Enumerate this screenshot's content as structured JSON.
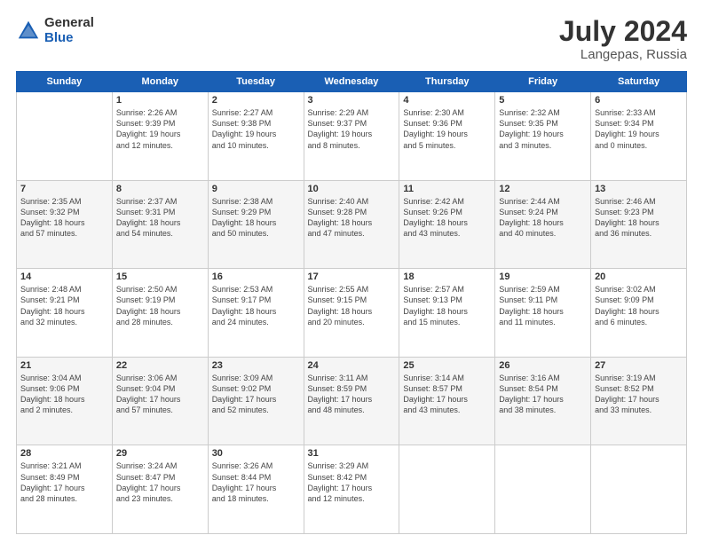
{
  "header": {
    "logo_general": "General",
    "logo_blue": "Blue",
    "month_year": "July 2024",
    "location": "Langepas, Russia"
  },
  "columns": [
    "Sunday",
    "Monday",
    "Tuesday",
    "Wednesday",
    "Thursday",
    "Friday",
    "Saturday"
  ],
  "weeks": [
    [
      {
        "day": "",
        "info": ""
      },
      {
        "day": "1",
        "info": "Sunrise: 2:26 AM\nSunset: 9:39 PM\nDaylight: 19 hours\nand 12 minutes."
      },
      {
        "day": "2",
        "info": "Sunrise: 2:27 AM\nSunset: 9:38 PM\nDaylight: 19 hours\nand 10 minutes."
      },
      {
        "day": "3",
        "info": "Sunrise: 2:29 AM\nSunset: 9:37 PM\nDaylight: 19 hours\nand 8 minutes."
      },
      {
        "day": "4",
        "info": "Sunrise: 2:30 AM\nSunset: 9:36 PM\nDaylight: 19 hours\nand 5 minutes."
      },
      {
        "day": "5",
        "info": "Sunrise: 2:32 AM\nSunset: 9:35 PM\nDaylight: 19 hours\nand 3 minutes."
      },
      {
        "day": "6",
        "info": "Sunrise: 2:33 AM\nSunset: 9:34 PM\nDaylight: 19 hours\nand 0 minutes."
      }
    ],
    [
      {
        "day": "7",
        "info": "Sunrise: 2:35 AM\nSunset: 9:32 PM\nDaylight: 18 hours\nand 57 minutes."
      },
      {
        "day": "8",
        "info": "Sunrise: 2:37 AM\nSunset: 9:31 PM\nDaylight: 18 hours\nand 54 minutes."
      },
      {
        "day": "9",
        "info": "Sunrise: 2:38 AM\nSunset: 9:29 PM\nDaylight: 18 hours\nand 50 minutes."
      },
      {
        "day": "10",
        "info": "Sunrise: 2:40 AM\nSunset: 9:28 PM\nDaylight: 18 hours\nand 47 minutes."
      },
      {
        "day": "11",
        "info": "Sunrise: 2:42 AM\nSunset: 9:26 PM\nDaylight: 18 hours\nand 43 minutes."
      },
      {
        "day": "12",
        "info": "Sunrise: 2:44 AM\nSunset: 9:24 PM\nDaylight: 18 hours\nand 40 minutes."
      },
      {
        "day": "13",
        "info": "Sunrise: 2:46 AM\nSunset: 9:23 PM\nDaylight: 18 hours\nand 36 minutes."
      }
    ],
    [
      {
        "day": "14",
        "info": "Sunrise: 2:48 AM\nSunset: 9:21 PM\nDaylight: 18 hours\nand 32 minutes."
      },
      {
        "day": "15",
        "info": "Sunrise: 2:50 AM\nSunset: 9:19 PM\nDaylight: 18 hours\nand 28 minutes."
      },
      {
        "day": "16",
        "info": "Sunrise: 2:53 AM\nSunset: 9:17 PM\nDaylight: 18 hours\nand 24 minutes."
      },
      {
        "day": "17",
        "info": "Sunrise: 2:55 AM\nSunset: 9:15 PM\nDaylight: 18 hours\nand 20 minutes."
      },
      {
        "day": "18",
        "info": "Sunrise: 2:57 AM\nSunset: 9:13 PM\nDaylight: 18 hours\nand 15 minutes."
      },
      {
        "day": "19",
        "info": "Sunrise: 2:59 AM\nSunset: 9:11 PM\nDaylight: 18 hours\nand 11 minutes."
      },
      {
        "day": "20",
        "info": "Sunrise: 3:02 AM\nSunset: 9:09 PM\nDaylight: 18 hours\nand 6 minutes."
      }
    ],
    [
      {
        "day": "21",
        "info": "Sunrise: 3:04 AM\nSunset: 9:06 PM\nDaylight: 18 hours\nand 2 minutes."
      },
      {
        "day": "22",
        "info": "Sunrise: 3:06 AM\nSunset: 9:04 PM\nDaylight: 17 hours\nand 57 minutes."
      },
      {
        "day": "23",
        "info": "Sunrise: 3:09 AM\nSunset: 9:02 PM\nDaylight: 17 hours\nand 52 minutes."
      },
      {
        "day": "24",
        "info": "Sunrise: 3:11 AM\nSunset: 8:59 PM\nDaylight: 17 hours\nand 48 minutes."
      },
      {
        "day": "25",
        "info": "Sunrise: 3:14 AM\nSunset: 8:57 PM\nDaylight: 17 hours\nand 43 minutes."
      },
      {
        "day": "26",
        "info": "Sunrise: 3:16 AM\nSunset: 8:54 PM\nDaylight: 17 hours\nand 38 minutes."
      },
      {
        "day": "27",
        "info": "Sunrise: 3:19 AM\nSunset: 8:52 PM\nDaylight: 17 hours\nand 33 minutes."
      }
    ],
    [
      {
        "day": "28",
        "info": "Sunrise: 3:21 AM\nSunset: 8:49 PM\nDaylight: 17 hours\nand 28 minutes."
      },
      {
        "day": "29",
        "info": "Sunrise: 3:24 AM\nSunset: 8:47 PM\nDaylight: 17 hours\nand 23 minutes."
      },
      {
        "day": "30",
        "info": "Sunrise: 3:26 AM\nSunset: 8:44 PM\nDaylight: 17 hours\nand 18 minutes."
      },
      {
        "day": "31",
        "info": "Sunrise: 3:29 AM\nSunset: 8:42 PM\nDaylight: 17 hours\nand 12 minutes."
      },
      {
        "day": "",
        "info": ""
      },
      {
        "day": "",
        "info": ""
      },
      {
        "day": "",
        "info": ""
      }
    ]
  ]
}
